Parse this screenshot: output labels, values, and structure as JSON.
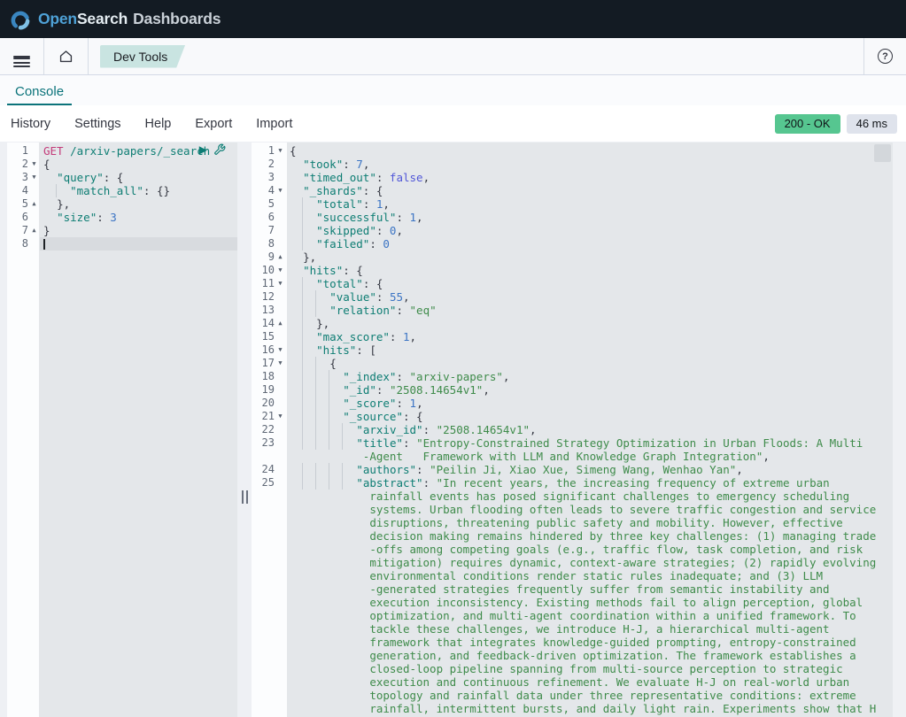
{
  "brand": {
    "open": "Open",
    "search": "Search",
    "dashboards": "Dashboards"
  },
  "nav": {
    "breadcrumb": "Dev Tools"
  },
  "tab": {
    "label": "Console"
  },
  "menu": {
    "items": [
      "History",
      "Settings",
      "Help",
      "Export",
      "Import"
    ]
  },
  "status": {
    "code": "200 - OK",
    "time": "46 ms"
  },
  "colors": {
    "header_bg": "#131b23",
    "accent_teal": "#0b737a",
    "breadcrumb_bg": "#c9e4e1",
    "status_ok_bg": "#56c690",
    "time_badge_bg": "#dfe3ec",
    "brand_blue": "#4ea1d6"
  },
  "request_editor": {
    "lines": [
      {
        "n": "1",
        "icons": true,
        "seg": [
          [
            "m",
            "GET"
          ],
          [
            "p",
            " "
          ],
          [
            "u",
            "/arxiv-papers/_search"
          ]
        ]
      },
      {
        "n": "2",
        "fold": "d",
        "seg": [
          [
            "p",
            "{"
          ]
        ]
      },
      {
        "n": "3",
        "fold": "d",
        "ind": 1,
        "seg": [
          [
            "k",
            "\"query\""
          ],
          [
            "p",
            ": {"
          ]
        ]
      },
      {
        "n": "4",
        "ind": 2,
        "seg": [
          [
            "k",
            "\"match_all\""
          ],
          [
            "p",
            ": {}"
          ]
        ]
      },
      {
        "n": "5",
        "fold": "u",
        "ind": 1,
        "seg": [
          [
            "p",
            "},"
          ]
        ]
      },
      {
        "n": "6",
        "ind": 1,
        "seg": [
          [
            "k",
            "\"size\""
          ],
          [
            "p",
            ": "
          ],
          [
            "num",
            "3"
          ]
        ]
      },
      {
        "n": "7",
        "fold": "u",
        "seg": [
          [
            "p",
            "}"
          ]
        ]
      },
      {
        "n": "8",
        "cur": true,
        "seg": []
      }
    ]
  },
  "response_editor": {
    "lines": [
      {
        "n": "1",
        "fold": "d",
        "seg": [
          [
            "p",
            "{"
          ]
        ]
      },
      {
        "n": "2",
        "ind": 1,
        "seg": [
          [
            "k",
            "\"took\""
          ],
          [
            "p",
            ": "
          ],
          [
            "num",
            "7"
          ],
          [
            "p",
            ","
          ]
        ]
      },
      {
        "n": "3",
        "ind": 1,
        "seg": [
          [
            "k",
            "\"timed_out\""
          ],
          [
            "p",
            ": "
          ],
          [
            "b",
            "false"
          ],
          [
            "p",
            ","
          ]
        ]
      },
      {
        "n": "4",
        "fold": "d",
        "ind": 1,
        "seg": [
          [
            "k",
            "\"_shards\""
          ],
          [
            "p",
            ": {"
          ]
        ]
      },
      {
        "n": "5",
        "ind": 2,
        "seg": [
          [
            "k",
            "\"total\""
          ],
          [
            "p",
            ": "
          ],
          [
            "num",
            "1"
          ],
          [
            "p",
            ","
          ]
        ]
      },
      {
        "n": "6",
        "ind": 2,
        "seg": [
          [
            "k",
            "\"successful\""
          ],
          [
            "p",
            ": "
          ],
          [
            "num",
            "1"
          ],
          [
            "p",
            ","
          ]
        ]
      },
      {
        "n": "7",
        "ind": 2,
        "seg": [
          [
            "k",
            "\"skipped\""
          ],
          [
            "p",
            ": "
          ],
          [
            "num",
            "0"
          ],
          [
            "p",
            ","
          ]
        ]
      },
      {
        "n": "8",
        "ind": 2,
        "seg": [
          [
            "k",
            "\"failed\""
          ],
          [
            "p",
            ": "
          ],
          [
            "num",
            "0"
          ]
        ]
      },
      {
        "n": "9",
        "fold": "u",
        "ind": 1,
        "seg": [
          [
            "p",
            "},"
          ]
        ]
      },
      {
        "n": "10",
        "fold": "d",
        "ind": 1,
        "seg": [
          [
            "k",
            "\"hits\""
          ],
          [
            "p",
            ": {"
          ]
        ]
      },
      {
        "n": "11",
        "fold": "d",
        "ind": 2,
        "seg": [
          [
            "k",
            "\"total\""
          ],
          [
            "p",
            ": {"
          ]
        ]
      },
      {
        "n": "12",
        "ind": 3,
        "seg": [
          [
            "k",
            "\"value\""
          ],
          [
            "p",
            ": "
          ],
          [
            "num",
            "55"
          ],
          [
            "p",
            ","
          ]
        ]
      },
      {
        "n": "13",
        "ind": 3,
        "seg": [
          [
            "k",
            "\"relation\""
          ],
          [
            "p",
            ": "
          ],
          [
            "s",
            "\"eq\""
          ]
        ]
      },
      {
        "n": "14",
        "fold": "u",
        "ind": 2,
        "seg": [
          [
            "p",
            "},"
          ]
        ]
      },
      {
        "n": "15",
        "ind": 2,
        "seg": [
          [
            "k",
            "\"max_score\""
          ],
          [
            "p",
            ": "
          ],
          [
            "num",
            "1"
          ],
          [
            "p",
            ","
          ]
        ]
      },
      {
        "n": "16",
        "fold": "d",
        "ind": 2,
        "seg": [
          [
            "k",
            "\"hits\""
          ],
          [
            "p",
            ": ["
          ]
        ]
      },
      {
        "n": "17",
        "fold": "d",
        "ind": 3,
        "seg": [
          [
            "p",
            "{"
          ]
        ]
      },
      {
        "n": "18",
        "ind": 4,
        "seg": [
          [
            "k",
            "\"_index\""
          ],
          [
            "p",
            ": "
          ],
          [
            "s",
            "\"arxiv-papers\""
          ],
          [
            "p",
            ","
          ]
        ]
      },
      {
        "n": "19",
        "ind": 4,
        "seg": [
          [
            "k",
            "\"_id\""
          ],
          [
            "p",
            ": "
          ],
          [
            "s",
            "\"2508.14654v1\""
          ],
          [
            "p",
            ","
          ]
        ]
      },
      {
        "n": "20",
        "ind": 4,
        "seg": [
          [
            "k",
            "\"_score\""
          ],
          [
            "p",
            ": "
          ],
          [
            "num",
            "1"
          ],
          [
            "p",
            ","
          ]
        ]
      },
      {
        "n": "21",
        "fold": "d",
        "ind": 4,
        "seg": [
          [
            "k",
            "\"_source\""
          ],
          [
            "p",
            ": {"
          ]
        ]
      },
      {
        "n": "22",
        "ind": 5,
        "seg": [
          [
            "k",
            "\"arxiv_id\""
          ],
          [
            "p",
            ": "
          ],
          [
            "s",
            "\"2508.14654v1\""
          ],
          [
            "p",
            ","
          ]
        ]
      },
      {
        "n": "23",
        "ind": 5,
        "seg": [
          [
            "k",
            "\"title\""
          ],
          [
            "p",
            ": "
          ],
          [
            "s",
            "\"Entropy-Constrained Strategy Optimization in Urban Floods: A Multi"
          ]
        ]
      },
      {
        "pad": 11,
        "seg": [
          [
            "s",
            "-Agent   Framework with LLM and Knowledge Graph Integration\""
          ],
          [
            "p",
            ","
          ]
        ]
      },
      {
        "n": "24",
        "ind": 5,
        "seg": [
          [
            "k",
            "\"authors\""
          ],
          [
            "p",
            ": "
          ],
          [
            "s",
            "\"Peilin Ji, Xiao Xue, Simeng Wang, Wenhao Yan\""
          ],
          [
            "p",
            ","
          ]
        ]
      },
      {
        "n": "25",
        "ind": 5,
        "seg": [
          [
            "k",
            "\"abstract\""
          ],
          [
            "p",
            ": "
          ],
          [
            "s",
            "\"In recent years, the increasing frequency of extreme urban"
          ]
        ]
      },
      {
        "pad": 12,
        "seg": [
          [
            "s",
            "rainfall events has posed significant challenges to emergency scheduling"
          ]
        ]
      },
      {
        "pad": 12,
        "seg": [
          [
            "s",
            "systems. Urban flooding often leads to severe traffic congestion and service"
          ]
        ]
      },
      {
        "pad": 12,
        "seg": [
          [
            "s",
            "disruptions, threatening public safety and mobility. However, effective"
          ]
        ]
      },
      {
        "pad": 12,
        "seg": [
          [
            "s",
            "decision making remains hindered by three key challenges: (1) managing trade"
          ]
        ]
      },
      {
        "pad": 12,
        "seg": [
          [
            "s",
            "-offs among competing goals (e.g., traffic flow, task completion, and risk"
          ]
        ]
      },
      {
        "pad": 12,
        "seg": [
          [
            "s",
            "mitigation) requires dynamic, context-aware strategies; (2) rapidly evolving"
          ]
        ]
      },
      {
        "pad": 12,
        "seg": [
          [
            "s",
            "environmental conditions render static rules inadequate; and (3) LLM"
          ]
        ]
      },
      {
        "pad": 12,
        "seg": [
          [
            "s",
            "-generated strategies frequently suffer from semantic instability and"
          ]
        ]
      },
      {
        "pad": 12,
        "seg": [
          [
            "s",
            "execution inconsistency. Existing methods fail to align perception, global"
          ]
        ]
      },
      {
        "pad": 12,
        "seg": [
          [
            "s",
            "optimization, and multi-agent coordination within a unified framework. To"
          ]
        ]
      },
      {
        "pad": 12,
        "seg": [
          [
            "s",
            "tackle these challenges, we introduce H-J, a hierarchical multi-agent"
          ]
        ]
      },
      {
        "pad": 12,
        "seg": [
          [
            "s",
            "framework that integrates knowledge-guided prompting, entropy-constrained"
          ]
        ]
      },
      {
        "pad": 12,
        "seg": [
          [
            "s",
            "generation, and feedback-driven optimization. The framework establishes a"
          ]
        ]
      },
      {
        "pad": 12,
        "seg": [
          [
            "s",
            "closed-loop pipeline spanning from multi-source perception to strategic"
          ]
        ]
      },
      {
        "pad": 12,
        "seg": [
          [
            "s",
            "execution and continuous refinement. We evaluate H-J on real-world urban"
          ]
        ]
      },
      {
        "pad": 12,
        "seg": [
          [
            "s",
            "topology and rainfall data under three representative conditions: extreme"
          ]
        ]
      },
      {
        "pad": 12,
        "seg": [
          [
            "s",
            "rainfall, intermittent bursts, and daily light rain. Experiments show that H"
          ]
        ]
      }
    ]
  }
}
